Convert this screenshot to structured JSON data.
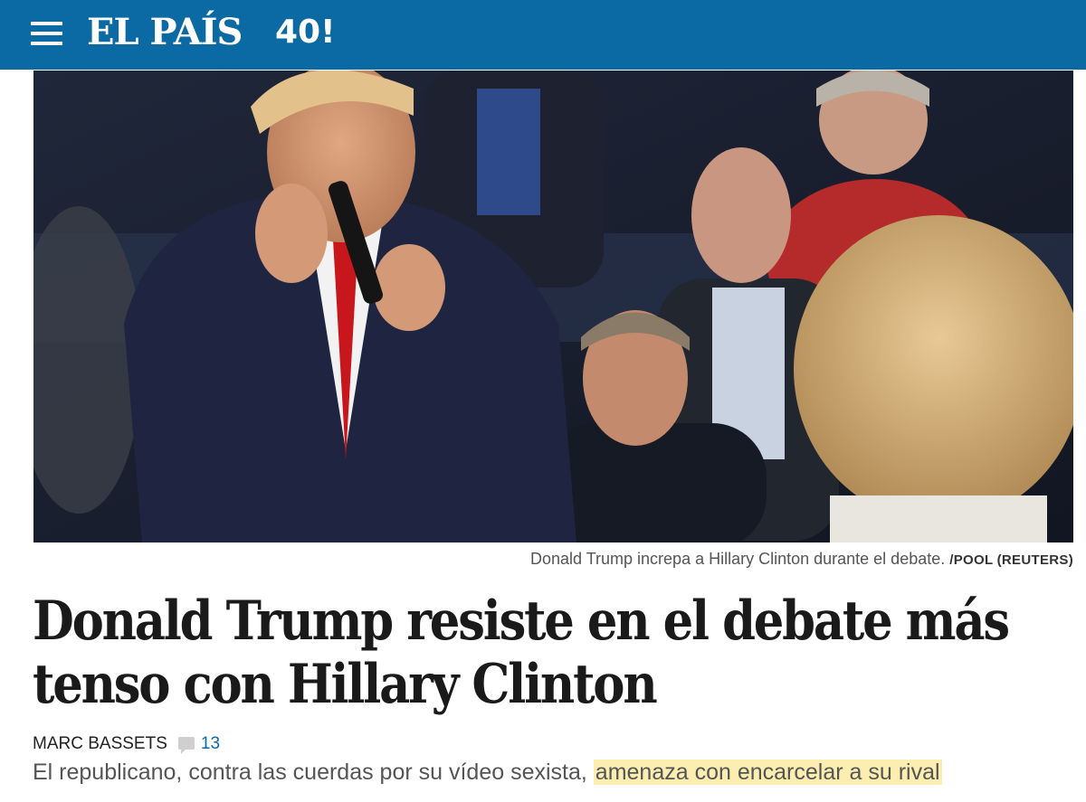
{
  "header": {
    "menu_icon": "hamburger-menu-icon",
    "brand": "EL PAÍS",
    "anniversary_badge": "40!",
    "background_color": "#0b69a3"
  },
  "photo": {
    "caption": "Donald Trump increpa a Hillary Clinton durante el debate.",
    "credit": "/POOL (REUTERS)"
  },
  "article": {
    "headline": "Donald Trump resiste en el debate más tenso con Hillary Clinton",
    "author": "MARC BASSETS",
    "comments_icon": "comment-bubble-icon",
    "comments_count": "13",
    "summary_plain": "El republicano, contra las cuerdas por su vídeo sexista,",
    "summary_highlighted": "amenaza con encarcelar a su rival",
    "highlight_color": "#fbeeb0",
    "link_color": "#0b69a3"
  }
}
